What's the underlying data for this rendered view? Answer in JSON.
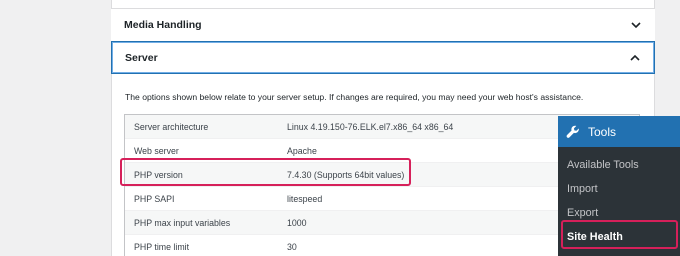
{
  "accordion": {
    "media_handling": "Media Handling",
    "server": "Server"
  },
  "server_section": {
    "description": "The options shown below relate to your server setup. If changes are required, you may need your web host's assistance.",
    "rows": [
      {
        "label": "Server architecture",
        "value": "Linux 4.19.150-76.ELK.el7.x86_64 x86_64"
      },
      {
        "label": "Web server",
        "value": "Apache"
      },
      {
        "label": "PHP version",
        "value": "7.4.30 (Supports 64bit values)"
      },
      {
        "label": "PHP SAPI",
        "value": "litespeed"
      },
      {
        "label": "PHP max input variables",
        "value": "1000"
      },
      {
        "label": "PHP time limit",
        "value": "30"
      }
    ]
  },
  "admin_menu": {
    "title": "Tools",
    "icon": "wrench-icon",
    "items": [
      "Available Tools",
      "Import",
      "Export",
      "Site Health"
    ],
    "current": "Site Health"
  },
  "colors": {
    "accent": "#2271b1",
    "highlight": "#d6205a",
    "menu_bg": "#2c3338"
  }
}
